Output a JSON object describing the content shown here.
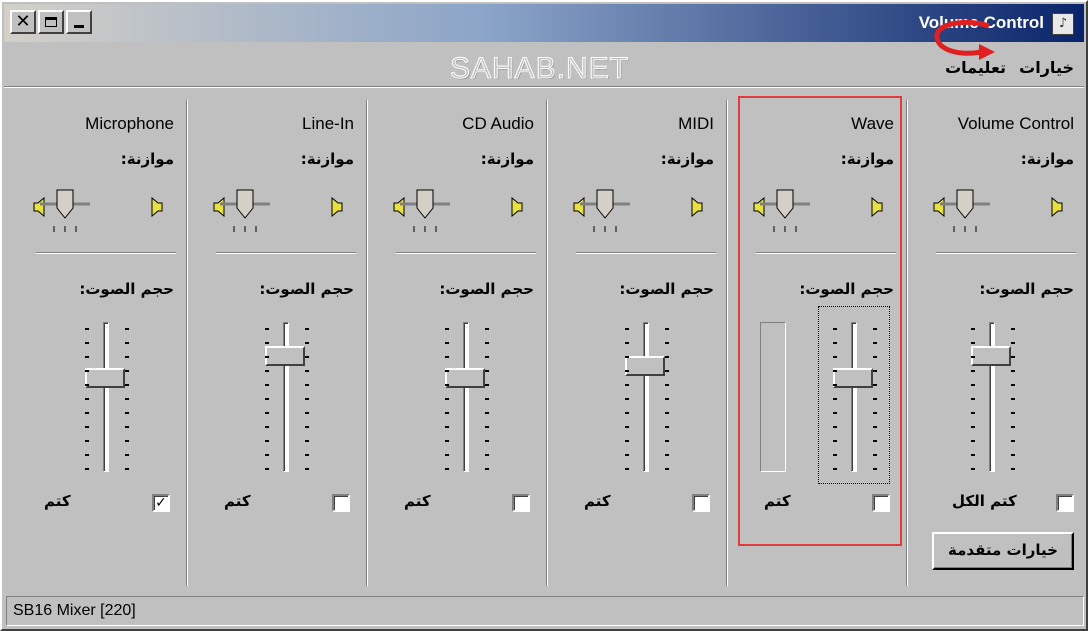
{
  "window": {
    "title": "Volume Control",
    "menu": [
      "خيارات",
      "تعليمات"
    ],
    "watermark": "SAHAB.NET",
    "status": "SB16 Mixer [220]"
  },
  "labels": {
    "balance": "موازنة:",
    "volume": "حجم الصوت:",
    "mute": "كتم",
    "mute_all": "كتم الكل",
    "advanced": "خيارات متقدمة"
  },
  "channels": [
    {
      "name": "Microphone",
      "muted": true,
      "volume": 0.62
    },
    {
      "name": "Line-In",
      "muted": false,
      "volume": 0.8
    },
    {
      "name": "CD Audio",
      "muted": false,
      "volume": 0.62
    },
    {
      "name": "MIDI",
      "muted": false,
      "volume": 0.7
    },
    {
      "name": "Wave",
      "muted": false,
      "volume": 0.62,
      "highlighted": true
    },
    {
      "name": "Volume Control",
      "muted": false,
      "volume": 0.8
    }
  ],
  "colors": {
    "highlight": "#e03c3c",
    "title_gradient_end": "#0a246a"
  },
  "icons": [
    "close-icon",
    "restore-icon",
    "minimize-icon",
    "speaker-left-icon",
    "speaker-right-icon",
    "app-icon"
  ]
}
